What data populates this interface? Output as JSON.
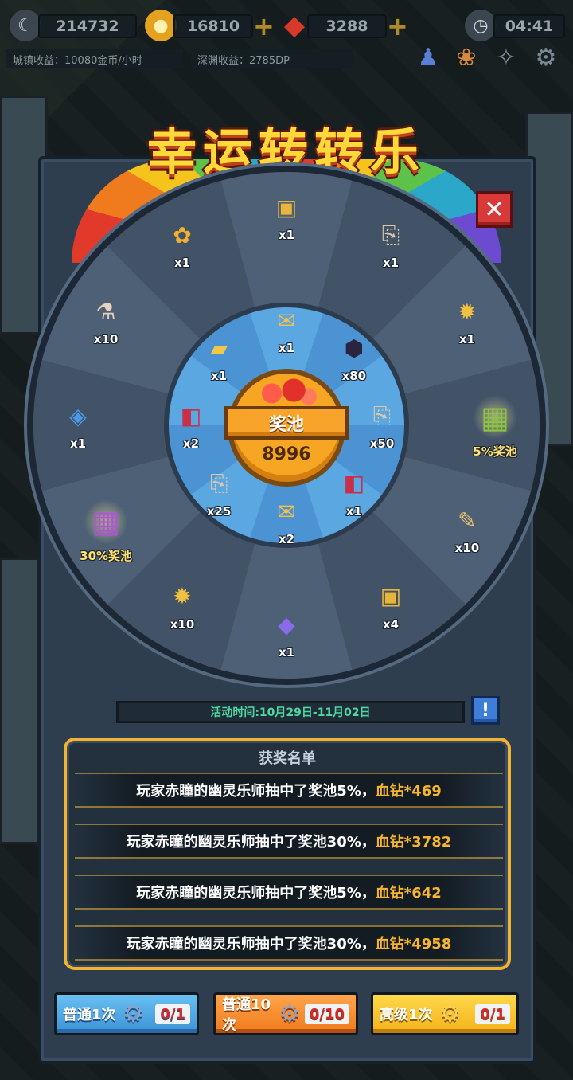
{
  "hud": {
    "score": "214732",
    "coins": "16810",
    "gems": "3288",
    "clock": "04:41",
    "town_income": "城镇收益：10080金币/小时",
    "abyss_income": "深渊收益：2785DP"
  },
  "title": "幸运转转乐",
  "close_label": "✕",
  "hub": {
    "label": "奖池",
    "value": "8996"
  },
  "outer_slots": [
    {
      "icon": "gold-bar-icon",
      "glyph": "▣",
      "color": "#e8b53a",
      "qty": "x1"
    },
    {
      "icon": "scroll-icon",
      "glyph": "⎘",
      "color": "#d9c9a8",
      "qty": "x1"
    },
    {
      "icon": "sun-amulet-icon",
      "glyph": "✹",
      "color": "#f0c040",
      "qty": "x1"
    },
    {
      "icon": "green-cube-icon",
      "glyph": "▦",
      "color": "#8bc63a",
      "qty": "5%奖池"
    },
    {
      "icon": "paper-scroll-icon",
      "glyph": "✎",
      "color": "#e8c070",
      "qty": "x10"
    },
    {
      "icon": "gold-bar-icon",
      "glyph": "▣",
      "color": "#e8b53a",
      "qty": "x4"
    },
    {
      "icon": "purple-crystal-icon",
      "glyph": "◆",
      "color": "#8a6ae8",
      "qty": "x1"
    },
    {
      "icon": "sun-amulet-icon",
      "glyph": "✹",
      "color": "#f0c040",
      "qty": "x10"
    },
    {
      "icon": "purple-cube-icon",
      "glyph": "▦",
      "color": "#b053d8",
      "qty": "30%奖池"
    },
    {
      "icon": "blue-card-icon",
      "glyph": "◈",
      "color": "#4a9ae8",
      "qty": "x1"
    },
    {
      "icon": "potion-icon",
      "glyph": "⚗",
      "color": "#e8d0c0",
      "qty": "x10"
    },
    {
      "icon": "gold-flower-icon",
      "glyph": "✿",
      "color": "#f0b030",
      "qty": "x1"
    }
  ],
  "inner_slots": [
    {
      "icon": "gold-scroll-icon",
      "glyph": "✉",
      "color": "#f4c04a",
      "qty": "x1"
    },
    {
      "icon": "dark-gem-icon",
      "glyph": "⬢",
      "color": "#2a2440",
      "qty": "x80"
    },
    {
      "icon": "scroll-icon",
      "glyph": "⎘",
      "color": "#d9c9a8",
      "qty": "x50"
    },
    {
      "icon": "red-book-icon",
      "glyph": "◧",
      "color": "#c8304a",
      "qty": "x1"
    },
    {
      "icon": "gold-scroll-icon",
      "glyph": "✉",
      "color": "#f4c04a",
      "qty": "x2"
    },
    {
      "icon": "scroll-icon",
      "glyph": "⎘",
      "color": "#d9c9a8",
      "qty": "x25"
    },
    {
      "icon": "red-book-icon",
      "glyph": "◧",
      "color": "#c8304a",
      "qty": "x2"
    },
    {
      "icon": "gold-card-icon",
      "glyph": "▰",
      "color": "#f0c848",
      "qty": "x1"
    }
  ],
  "event_time": "活动时间:10月29日-11月02日",
  "info_label": "!",
  "winners": {
    "title": "获奖名单",
    "rows": [
      {
        "text": "玩家赤瞳的幽灵乐师抽中了奖池5%，",
        "prize": "血钻*469"
      },
      {
        "text": "玩家赤瞳的幽灵乐师抽中了奖池30%，",
        "prize": "血钻*3782"
      },
      {
        "text": "玩家赤瞳的幽灵乐师抽中了奖池5%，",
        "prize": "血钻*642"
      },
      {
        "text": "玩家赤瞳的幽灵乐师抽中了奖池30%，",
        "prize": "血钻*4958"
      }
    ]
  },
  "buttons": [
    {
      "label": "普通1次",
      "count": "0/1"
    },
    {
      "label": "普通10次",
      "count": "0/10"
    },
    {
      "label": "高级1次",
      "count": "0/1"
    }
  ],
  "colors": {
    "accent_gold": "#f2b232",
    "event_time": "#4ed8a0",
    "prize": "#f7b42e"
  }
}
